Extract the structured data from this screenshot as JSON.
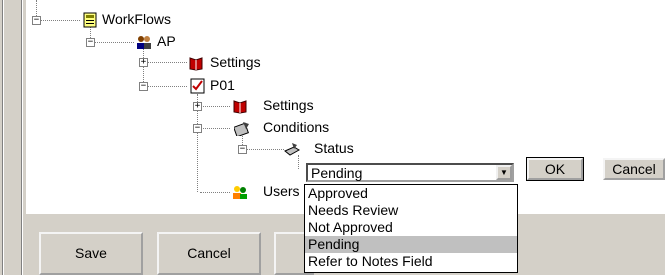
{
  "tree": {
    "workflows_label": "WorkFlows",
    "ap_label": "AP",
    "ap_settings_label": "Settings",
    "po1_label": "P01",
    "po1_settings_label": "Settings",
    "conditions_label": "Conditions",
    "status_label": "Status",
    "users_label": "Users"
  },
  "status_editor": {
    "selected_value": "Pending",
    "options": [
      "Approved",
      "Needs Review",
      "Not Approved",
      "Pending",
      "Refer to Notes Field"
    ],
    "ok_label": "OK",
    "cancel_label": "Cancel"
  },
  "footer": {
    "save_label": "Save",
    "cancel_label": "Cancel"
  },
  "colors": {
    "window_face": "#d4d0c8",
    "tree_background": "#ffffff",
    "selected_option": "#c0c0c0"
  }
}
